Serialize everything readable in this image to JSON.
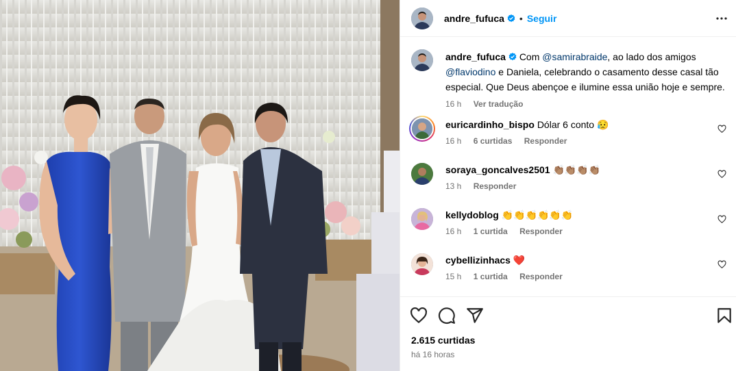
{
  "post": {
    "username": "andre_fufuca",
    "separator": "•",
    "follow_label": "Seguir",
    "caption": {
      "prefix": "Com",
      "mention1": "@samirabraide",
      "text1": ", ao lado dos amigos",
      "mention2": "@flaviodino",
      "text2": " e Daniela, celebrando o casamento desse casal tão especial. Que Deus abençoe e ilumine essa união hoje e sempre.",
      "time": "16 h",
      "translate": "Ver tradução"
    },
    "likes": "2.615 curtidas",
    "posted": "há 16 horas"
  },
  "comments": [
    {
      "username": "euricardinho_bispo",
      "text": "Dólar 6 conto 😥",
      "time": "16 h",
      "likes": "6 curtidas",
      "reply": "Responder"
    },
    {
      "username": "soraya_goncalves2501",
      "text": "👏🏽👏🏽👏🏽👏🏽",
      "time": "13 h",
      "likes": "",
      "reply": "Responder"
    },
    {
      "username": "kellydoblog",
      "text": "👏👏👏👏👏👏",
      "time": "16 h",
      "likes": "1 curtida",
      "reply": "Responder"
    },
    {
      "username": "cybellizinhacs",
      "text": "❤️",
      "time": "15 h",
      "likes": "1 curtida",
      "reply": "Responder"
    }
  ],
  "colors": {
    "accent": "#0095f6",
    "verified": "#0095f6",
    "link": "#00376b",
    "muted": "#737373"
  },
  "icons": {
    "header": [
      "verified-badge-icon",
      "more-options-icon"
    ],
    "actions": [
      "like-heart-icon",
      "comment-icon",
      "share-icon",
      "save-bookmark-icon"
    ],
    "comment": "comment-like-heart-icon"
  }
}
